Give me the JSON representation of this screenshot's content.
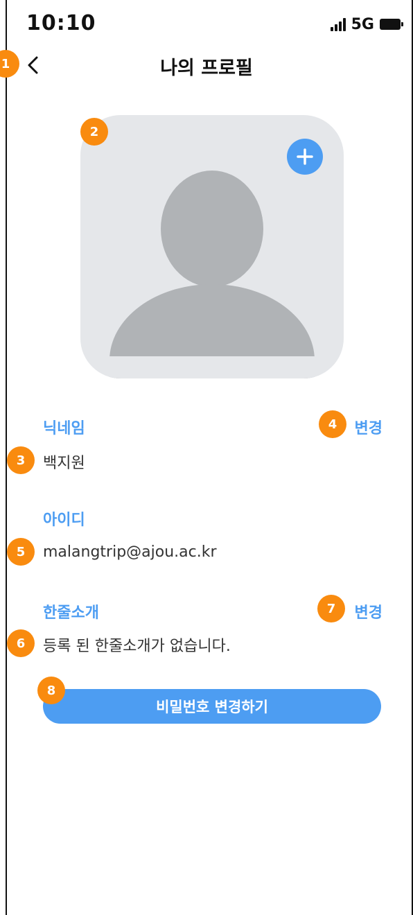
{
  "status_bar": {
    "time": "10:10",
    "network": "5G",
    "signal_icon": "signal-bars-icon",
    "battery_icon": "battery-icon"
  },
  "header": {
    "title": "나의 프로필",
    "back_icon": "chevron-left-icon"
  },
  "profile_photo": {
    "placeholder_icon": "person-silhouette-icon",
    "add_icon": "plus-circle-icon",
    "background_color": "#e5e7ea",
    "silhouette_color": "#b0b3b6"
  },
  "fields": {
    "nickname": {
      "label": "닉네임",
      "value": "백지원",
      "change_label": "변경"
    },
    "user_id": {
      "label": "아이디",
      "value": "malangtrip@ajou.ac.kr"
    },
    "bio": {
      "label": "한줄소개",
      "value": "등록 된 한줄소개가 없습니다.",
      "change_label": "변경"
    }
  },
  "actions": {
    "change_password_label": "비밀번호 변경하기"
  },
  "markers": [
    "1",
    "2",
    "3",
    "4",
    "5",
    "6",
    "7",
    "8"
  ],
  "colors": {
    "accent": "#4d9df2",
    "marker": "#f98b0f",
    "text": "#333333"
  }
}
